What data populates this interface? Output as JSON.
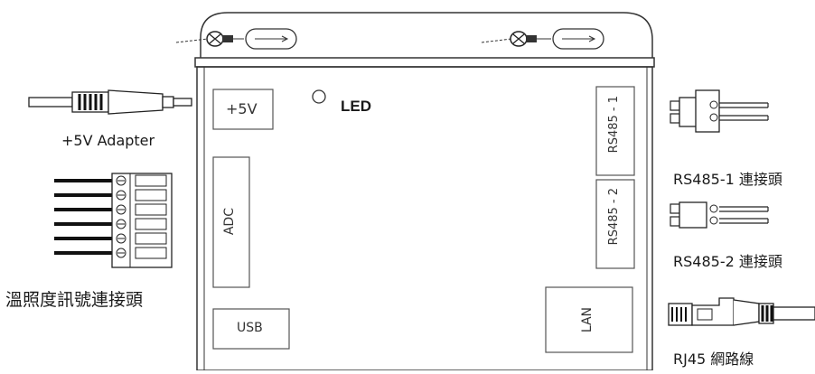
{
  "board": {
    "power_label": "+5V",
    "led_label": "LED",
    "adc_label": "ADC",
    "usb_label": "USB",
    "rs485_1_label": "RS485 - 1",
    "rs485_2_label": "RS485 - 2",
    "lan_label": "LAN"
  },
  "callouts": {
    "adapter": "+5V Adapter",
    "sensor_connector": "溫照度訊號連接頭",
    "rs485_1_connector": "RS485-1 連接頭",
    "rs485_2_connector": "RS485-2 連接頭",
    "rj45_cable": "RJ45 網路線"
  }
}
